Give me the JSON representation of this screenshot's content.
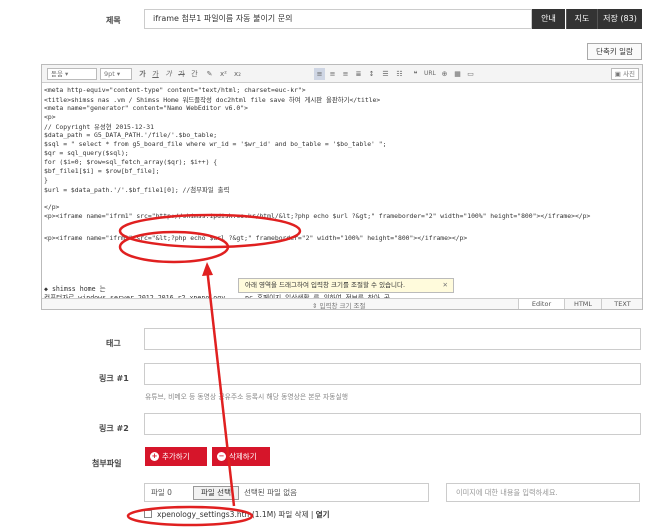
{
  "subject": {
    "label": "제목",
    "value": "iframe 첨부1 파일이름 자동 불이기 문의",
    "buttons": [
      "안내",
      "지도",
      "저장 (83)"
    ]
  },
  "shortcut_button": "단축키 일람",
  "toolbar": {
    "font_select": "돋움",
    "size_select": "9pt",
    "buttons": [
      "가",
      "가",
      "가",
      "가",
      "간",
      "",
      "가",
      "가"
    ],
    "photo_button": "사진"
  },
  "code_lines": [
    "<meta http-equiv=\"content-type\" content=\"text/html; charset=euc-kr\">",
    "<title>shimss nas .vm / Shimss Home 워드플작성 doc2html file save 하여 게시판 올판하기</title>",
    "<meta name=\"generator\" content=\"Namo WebEditor v6.0\">",
    "<p>",
    "// Copyright 유성현 2015-12-31",
    "$data_path = G5_DATA_PATH.'/file/'.$bo_table;",
    "$sql = \" select * from g5_board_file where wr_id = '$wr_id' and bo_table = '$bo_table' \";",
    "$qr = sql_query($sql);",
    "for ($i=0; $row=sql_fetch_array($qr); $i++) {",
    " $bf_file1[$i] = $row[bf_file];",
    "}",
    "$url = $data_path.'/'.$bf_file1[0]; //첨부파일 출력",
    "",
    "</p>",
    "<p><iframe name=\"ifrm1\" src=\"http://shimss.ipdisk.co.kr/html/&lt;?php echo $url ?&gt;\" frameborder=\"2\" width=\"100%\" height=\"800\"></iframe></p>",
    "",
    "<p><iframe name=\"ifrm1\" src=\"&lt;?php echo $url ?&gt;\" frameborder=\"2\" width=\"100%\" height=\"800\"></iframe></p>"
  ],
  "bottom_lines": [
    "◆ shimss home 는",
    "컴퓨터자료 windows server 2012 2016 r2 xpenology ... pc 홈페이지 일상생활 를 위하여 정보를 찾아 공"
  ],
  "tooltip": {
    "text": "아래 영역을 드래그하여 입력창 크기를 조절할 수 있습니다.",
    "close": "✕"
  },
  "resize_label": "⇕ 입력창 크기 조절",
  "editor_modes": [
    "Editor",
    "HTML",
    "TEXT"
  ],
  "tag": {
    "label": "태그",
    "value": ""
  },
  "link1": {
    "label": "링크 #1",
    "value": "",
    "hint": "유튜브, 비메오 등 동영상 공유주소 등록시 해당 동영상은 본문 자동실행"
  },
  "link2": {
    "label": "링크 #2",
    "value": ""
  },
  "attach": {
    "label": "첨부파일",
    "add_button": "추가하기",
    "delete_button": "삭제하기",
    "file_count": "파일 0",
    "file_select": "파일 선택",
    "file_none": "선택된 파일 없음",
    "desc_placeholder": "이미지에 대한 내용을 입력하세요.",
    "existing_name": "xpenology_settings3.htm",
    "existing_size": "(1.1M)",
    "existing_delete": "파일 삭제",
    "existing_open": "열기"
  },
  "colors": {
    "accent_red": "#d6152a",
    "dark": "#333333",
    "annotation": "#e02020"
  }
}
